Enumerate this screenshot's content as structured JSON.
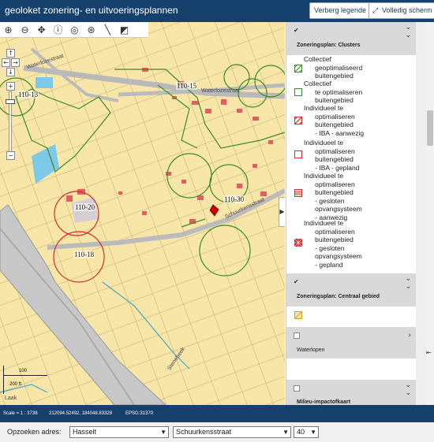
{
  "header": {
    "title": "geoloket zonering- en uitvoeringsplannen",
    "hide_legend_label": "Verberg legende",
    "fullscreen_label": "Volledig scherm"
  },
  "map": {
    "tools": [
      "zoom-in-icon",
      "zoom-out-icon",
      "pan-icon",
      "info-icon",
      "zoom-box-icon",
      "zoom-box-out-icon",
      "measure-icon",
      "identify-icon"
    ],
    "cluster_labels": [
      {
        "id": "l1",
        "text": "110-15"
      },
      {
        "id": "l2",
        "text": "110-13"
      },
      {
        "id": "l3",
        "text": "110-30"
      },
      {
        "id": "l4",
        "text": "110-20"
      },
      {
        "id": "l5",
        "text": "110-18"
      }
    ],
    "street_labels": {
      "waterloze": "Waterlozestraat",
      "waterloze2": "Waterlozestraat",
      "schuurkens": "Schuurkensstraat",
      "beek": "Stenebeek",
      "laak": "Laak"
    },
    "scale_text": "200 ft",
    "scale_text2": "100"
  },
  "legend_panel": {
    "sections": [
      {
        "title": "Zoneringsplan: Clusters",
        "checked": true
      },
      {
        "title": "Zoneringsplan: Centraal gebied",
        "checked": true
      },
      {
        "title": "Waterlopen",
        "checked": false
      },
      {
        "title": "Milieu-impactofkaart",
        "checked": false
      }
    ],
    "cluster_items": [
      {
        "label": "Collectief\n      geoptimaliseerd\n      buitengebied",
        "swatch": "hatch-green"
      },
      {
        "label": "Collectief\n      te optimaliseren\n      buitengebied",
        "swatch": "outline-green"
      },
      {
        "label": "Individueel te\n      optimaliseren\n      buitengebied\n      - IBA - aanwezig",
        "swatch": "hatch-red"
      },
      {
        "label": "Individueel te\n      optimaliseren\n      buitengebied\n      - IBA - gepland",
        "swatch": "outline-red"
      },
      {
        "label": "Individueel te\n      optimaliseren\n      buitengebied\n      - gesloten\n      opvangsysteem\n      - aanwezig",
        "swatch": "lines-red"
      },
      {
        "label": "Individueel te\n      optimaliseren\n      buitengebied\n      - gesloten\n      opvangsysteem\n      - gepland",
        "swatch": "cross-red"
      }
    ]
  },
  "status": {
    "scale": "Scale = 1 : 3738",
    "coords": "212094.52492, 184048.83328",
    "epsg": "EPSG:31370"
  },
  "search": {
    "label": "Opzoeken adres:",
    "municipality": "Hasselt",
    "street": "Schuurkensstraat",
    "number": "40"
  },
  "colors": {
    "header_bg": "#15406b",
    "map_bg": "#f8e6a8",
    "cluster_green": "#3c8a2c",
    "cluster_red": "#d42b2b"
  }
}
